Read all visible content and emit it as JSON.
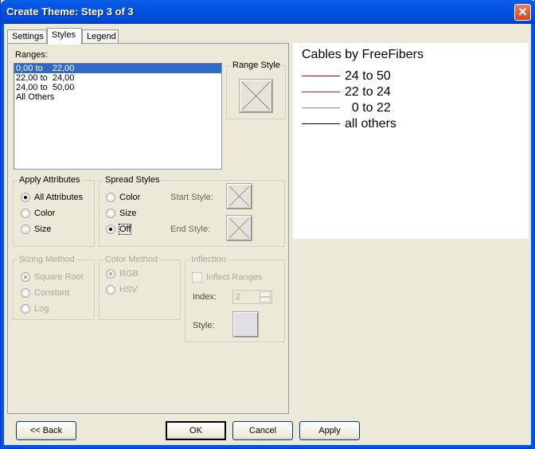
{
  "window": {
    "title": "Create Theme: Step 3 of 3",
    "close_icon": "close-icon"
  },
  "tabs": [
    {
      "label": "Settings",
      "active": false
    },
    {
      "label": "Styles",
      "active": true
    },
    {
      "label": "Legend",
      "active": false
    }
  ],
  "ranges": {
    "label": "Ranges:",
    "items": [
      "0,00 to    22,00",
      "22,00 to  24,00",
      "24,00 to  50,00",
      "All Others"
    ],
    "selected_index": 0
  },
  "range_style": {
    "label": "Range Style"
  },
  "apply_attributes": {
    "label": "Apply Attributes",
    "options": [
      "All Attributes",
      "Color",
      "Size"
    ],
    "selected": "All Attributes"
  },
  "spread_styles": {
    "label": "Spread Styles",
    "options": [
      "Color",
      "Size",
      "Off"
    ],
    "selected": "Off",
    "start_style_label": "Start Style:",
    "end_style_label": "End Style:"
  },
  "sizing_method": {
    "label": "Sizing Method",
    "options": [
      "Square Root",
      "Constant",
      "Log"
    ],
    "selected": "Square Root",
    "disabled": true
  },
  "color_method": {
    "label": "Color Method",
    "options": [
      "RGB",
      "HSV"
    ],
    "selected": "RGB",
    "disabled": true
  },
  "inflection": {
    "label": "Inflection",
    "inflect_ranges_label": "Inflect Ranges",
    "inflect_ranges_checked": false,
    "index_label": "Index:",
    "index_value": "2",
    "style_label": "Style:"
  },
  "preview": {
    "title": "Cables by FreeFibers",
    "entries": [
      {
        "label": "24 to 50",
        "color": "#cc0000"
      },
      {
        "label": "22 to 24",
        "color": "#cc2222"
      },
      {
        "label": "  0 to 22",
        "color": "#888888"
      },
      {
        "label": "all others",
        "color": "#000000"
      }
    ]
  },
  "buttons": {
    "back": "<< Back",
    "ok": "OK",
    "cancel": "Cancel",
    "apply": "Apply"
  }
}
